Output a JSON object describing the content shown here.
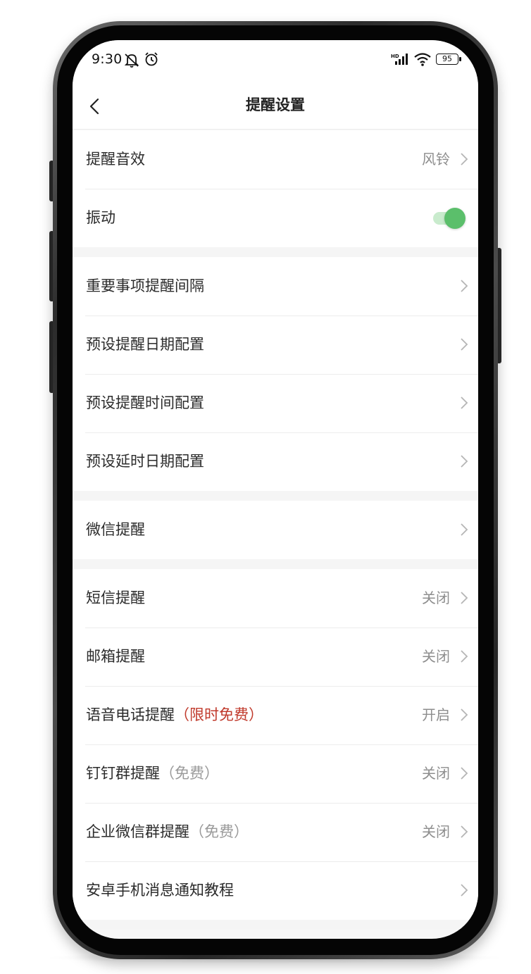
{
  "status_bar": {
    "time": "9:30",
    "battery": "95",
    "icons": [
      "mute-icon",
      "alarm-icon",
      "hd-signal-icon",
      "wifi-icon",
      "battery-icon"
    ]
  },
  "header": {
    "title": "提醒设置",
    "back_icon": "chevron-left-icon"
  },
  "groups": [
    {
      "items": [
        {
          "label": "提醒音效",
          "value": "风铃"
        },
        {
          "label": "振动",
          "toggle_on": true,
          "accent": "#5bbf6b"
        }
      ]
    },
    {
      "items": [
        {
          "label": "重要事项提醒间隔"
        },
        {
          "label": "预设提醒日期配置"
        },
        {
          "label": "预设提醒时间配置"
        },
        {
          "label": "预设延时日期配置"
        }
      ]
    },
    {
      "items": [
        {
          "label": "微信提醒"
        }
      ]
    },
    {
      "items": [
        {
          "label": "短信提醒",
          "value": "关闭"
        },
        {
          "label": "邮箱提醒",
          "value": "关闭"
        },
        {
          "label": "语音电话提醒",
          "tag": "（限时免费）",
          "tag_color": "#c0392b",
          "value": "开启"
        },
        {
          "label": "钉钉群提醒",
          "tag": "（免费）",
          "value": "关闭"
        },
        {
          "label": "企业微信群提醒",
          "tag": "（免费）",
          "value": "关闭"
        },
        {
          "label": "安卓手机消息通知教程"
        }
      ]
    }
  ]
}
